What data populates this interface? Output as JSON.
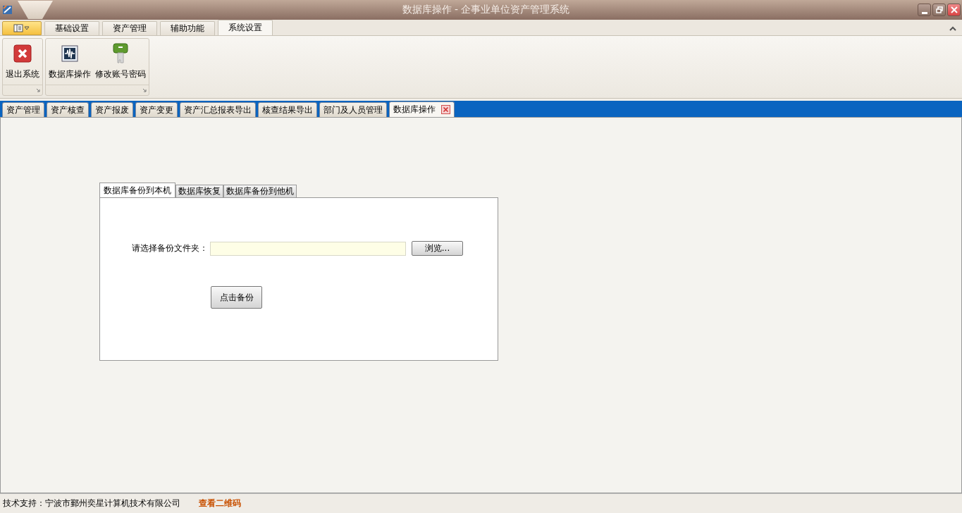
{
  "window": {
    "title": "数据库操作 - 企事业单位资产管理系统"
  },
  "ribbon": {
    "tabs": [
      {
        "label": "基础设置",
        "selected": false
      },
      {
        "label": "资产管理",
        "selected": false
      },
      {
        "label": "辅助功能",
        "selected": false
      },
      {
        "label": "系统设置",
        "selected": true
      }
    ],
    "groups": [
      {
        "buttons": [
          {
            "label": "退出系统",
            "kind": "exit"
          }
        ]
      },
      {
        "buttons": [
          {
            "label": "数据库操作",
            "kind": "database"
          },
          {
            "label": "修改账号密码",
            "kind": "key"
          }
        ]
      }
    ]
  },
  "document_tabs": [
    {
      "label": "资产管理",
      "selected": false,
      "closable": false
    },
    {
      "label": "资产核查",
      "selected": false,
      "closable": false
    },
    {
      "label": "资产报废",
      "selected": false,
      "closable": false
    },
    {
      "label": "资产变更",
      "selected": false,
      "closable": false
    },
    {
      "label": "资产汇总报表导出",
      "selected": false,
      "closable": false
    },
    {
      "label": "核查结果导出",
      "selected": false,
      "closable": false
    },
    {
      "label": "部门及人员管理",
      "selected": false,
      "closable": false
    },
    {
      "label": "数据库操作",
      "selected": true,
      "closable": true
    }
  ],
  "backup_panel": {
    "tabs": [
      {
        "label": "数据库备份到本机",
        "selected": true
      },
      {
        "label": "数据库恢复",
        "selected": false
      },
      {
        "label": "数据库备份到他机",
        "selected": false
      }
    ],
    "folder_label": "请选择备份文件夹：",
    "browse_button": "浏览...",
    "backup_button": "点击备份"
  },
  "status_bar": {
    "support_text": "技术支持：宁波市鄞州奕星计算机技术有限公司",
    "qr_link": "查看二维码"
  }
}
